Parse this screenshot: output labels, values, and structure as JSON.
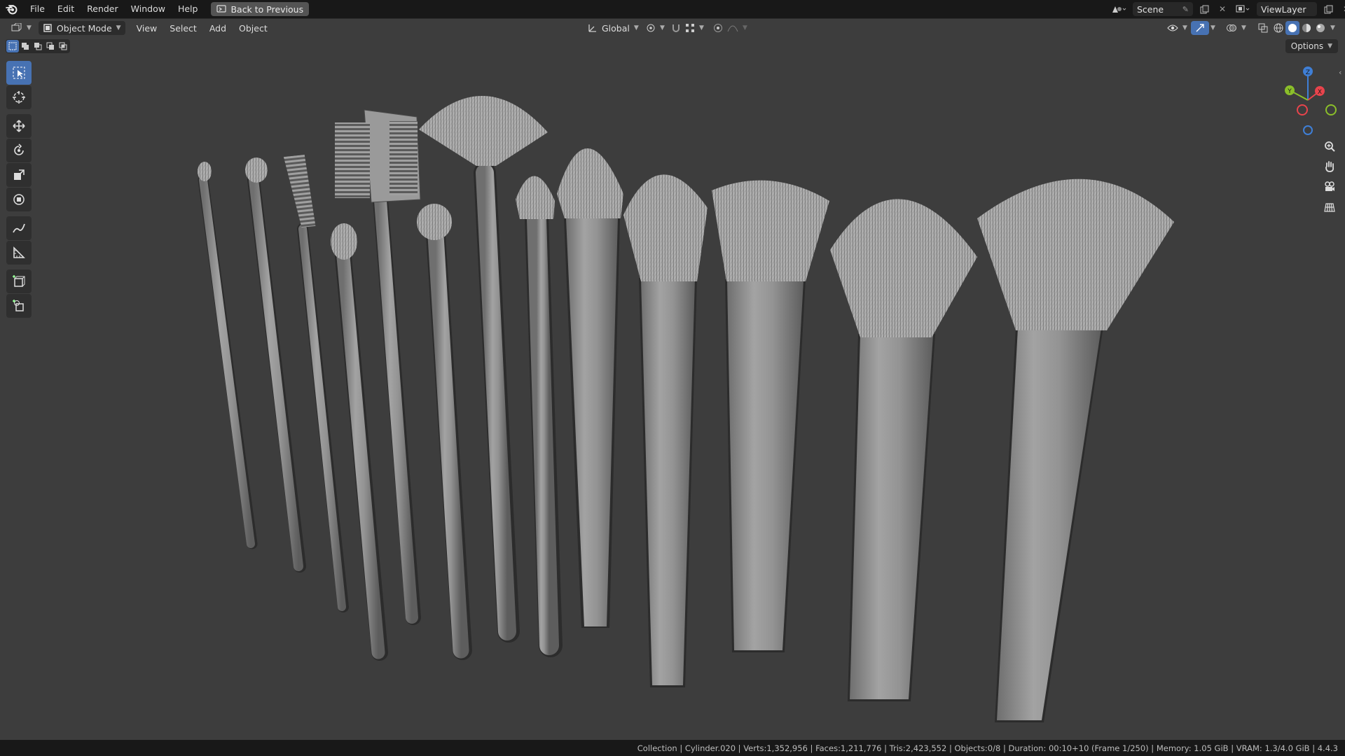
{
  "topbar": {
    "menu": [
      "File",
      "Edit",
      "Render",
      "Window",
      "Help"
    ],
    "back_button": "Back to Previous",
    "scene_name": "Scene",
    "view_layer": "ViewLayer"
  },
  "viewport_header": {
    "mode": "Object Mode",
    "menus": [
      "View",
      "Select",
      "Add",
      "Object"
    ],
    "transform_orientation": "Global",
    "options": "Options"
  },
  "toolbar": {
    "tools": [
      "select-box",
      "cursor",
      "move",
      "rotate",
      "scale",
      "transform",
      "annotate",
      "measure",
      "add-cube",
      "add-object"
    ],
    "active": "select-box"
  },
  "gizmo": {
    "x": "X",
    "y": "Y",
    "z": "Z"
  },
  "colors": {
    "accent": "#4772b3",
    "viewport_bg": "#3d3d3d",
    "axis_x": "#e8444c",
    "axis_y": "#8bbf2a",
    "axis_z": "#3f7fd6"
  },
  "status": {
    "text": "Collection | Cylinder.020 | Verts:1,352,956 | Faces:1,211,776 | Tris:2,423,552 | Objects:0/8 | Duration: 00:10+10 (Frame 1/250) | Memory: 1.05 GiB | VRAM: 1.3/4.0 GiB | 4.4.3"
  }
}
